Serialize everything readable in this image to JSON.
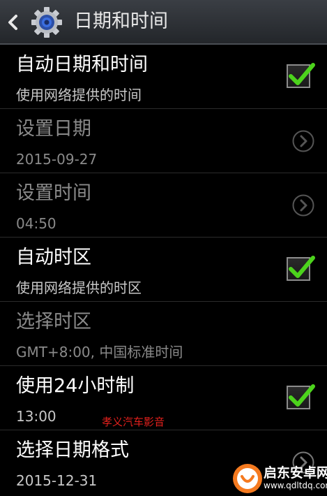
{
  "header": {
    "title": "日期和时间",
    "back_icon": "back-arrow-icon",
    "settings_icon": "gear-icon"
  },
  "rows": [
    {
      "primary": "自动日期和时间",
      "secondary": "使用网络提供的时间",
      "control": "checkbox",
      "checked": true,
      "enabled": true
    },
    {
      "primary": "设置日期",
      "secondary": "2015-09-27",
      "control": "chevron",
      "enabled": false
    },
    {
      "primary": "设置时间",
      "secondary": "04:50",
      "control": "chevron",
      "enabled": false
    },
    {
      "primary": "自动时区",
      "secondary": "使用网络提供的时区",
      "control": "checkbox",
      "checked": true,
      "enabled": true
    },
    {
      "primary": "选择时区",
      "secondary": "GMT+8:00, 中国标准时间",
      "control": "none",
      "enabled": false
    },
    {
      "primary": "使用24小时制",
      "secondary": "13:00",
      "control": "checkbox",
      "checked": true,
      "enabled": true
    },
    {
      "primary": "选择日期格式",
      "secondary": "2015-12-31",
      "control": "chevron",
      "enabled": true
    }
  ],
  "watermark": "孝义汽车影音",
  "site_logo": {
    "name": "启东安卓网",
    "url": "www.qdltdq.com"
  },
  "colors": {
    "check_green": "#4cd31c",
    "header_bg": "#2c2f33",
    "watermark": "#e0201c"
  }
}
